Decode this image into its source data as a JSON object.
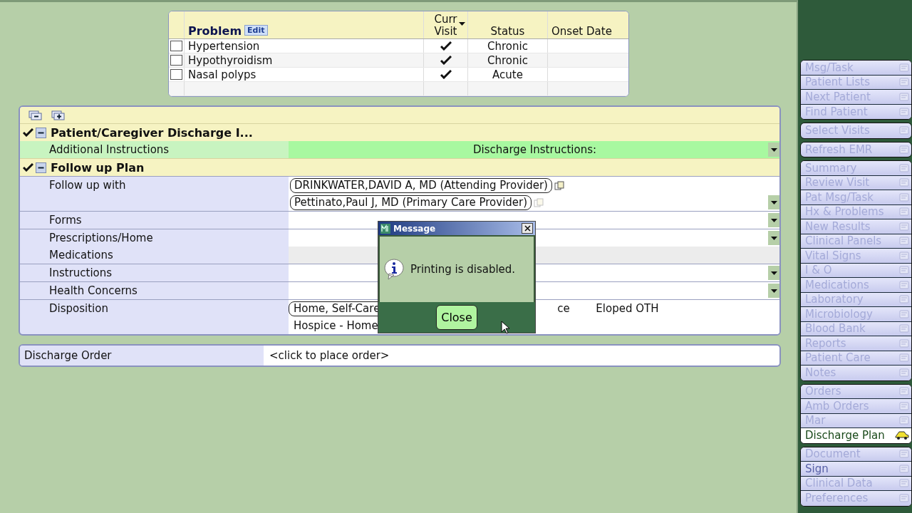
{
  "problem_list": {
    "header": {
      "problem": "Problem",
      "edit": "Edit",
      "curr_visit": "Curr Visit",
      "status": "Status",
      "onset_date": "Onset Date"
    },
    "rows": [
      {
        "checked": false,
        "problem": "Hypertension",
        "curr_visit": true,
        "status": "Chronic"
      },
      {
        "checked": false,
        "problem": "Hypothyroidism",
        "curr_visit": true,
        "status": "Chronic"
      },
      {
        "checked": false,
        "problem": "Nasal polyps",
        "curr_visit": true,
        "status": "Acute"
      }
    ]
  },
  "form": {
    "sections": [
      {
        "title": "Patient/Caregiver Discharge I...",
        "complete": true,
        "expanded": true,
        "rows": [
          {
            "kind": "banner",
            "labels": [
              "Additional Instructions"
            ],
            "value": "Discharge Instructions:",
            "dropdown": true
          }
        ]
      },
      {
        "title": "Follow up Plan",
        "complete": true,
        "expanded": true,
        "rows": [
          {
            "kind": "chips",
            "labels": [
              "Follow up with"
            ],
            "chips": [
              "DRINKWATER,DAVID A, MD (Attending Provider)",
              "Pettinato,Paul J, MD (Primary Care Provider)"
            ],
            "dropdown": true
          },
          {
            "kind": "select",
            "labels": [
              "Forms"
            ],
            "dropdown": true
          },
          {
            "kind": "select",
            "labels": [
              "Prescriptions/Home",
              "Medications"
            ],
            "dropdown": true
          },
          {
            "kind": "select",
            "labels": [
              "Instructions"
            ],
            "dropdown": true
          },
          {
            "kind": "select",
            "labels": [
              "Health Concerns"
            ],
            "dropdown": true
          },
          {
            "kind": "options",
            "labels": [
              "Disposition"
            ],
            "option_lines": [
              [
                {
                  "text": "Home, Self-Care",
                  "selected": true
                },
                {
                  "text": "ce",
                  "selected": false
                },
                {
                  "text": "Eloped OTH",
                  "selected": false
                }
              ],
              [
                {
                  "text": "Hospice - Home",
                  "selected": false
                }
              ]
            ]
          }
        ]
      }
    ]
  },
  "order": {
    "label": "Discharge Order",
    "value": "<click to place order>"
  },
  "dialog": {
    "title": "Message",
    "message": "Printing is disabled.",
    "button": "Close"
  },
  "sidebar": {
    "groups": [
      {
        "items": [
          {
            "label": "Msg/Task",
            "selected": false,
            "disabled": true
          },
          {
            "label": "Patient Lists",
            "selected": false,
            "disabled": true
          },
          {
            "label": "Next Patient",
            "selected": false,
            "disabled": true
          },
          {
            "label": "Find Patient",
            "selected": false,
            "disabled": true
          }
        ]
      },
      {
        "items": [
          {
            "label": "Select Visits",
            "selected": false,
            "disabled": true
          }
        ]
      },
      {
        "items": [
          {
            "label": "Refresh EMR",
            "selected": false,
            "disabled": true
          }
        ]
      },
      {
        "items": [
          {
            "label": "Summary",
            "selected": false,
            "disabled": true
          },
          {
            "label": "Review Visit",
            "selected": false,
            "disabled": true
          },
          {
            "label": "Pat Msg/Task",
            "selected": false,
            "disabled": true
          },
          {
            "label": "Hx & Problems",
            "selected": false,
            "disabled": true
          },
          {
            "label": "New Results",
            "selected": false,
            "disabled": true
          },
          {
            "label": "Clinical Panels",
            "selected": false,
            "disabled": true
          },
          {
            "label": "Vital Signs",
            "selected": false,
            "disabled": true
          },
          {
            "label": "I & O",
            "selected": false,
            "disabled": true
          },
          {
            "label": "Medications",
            "selected": false,
            "disabled": true
          },
          {
            "label": "Laboratory",
            "selected": false,
            "disabled": true
          },
          {
            "label": "Microbiology",
            "selected": false,
            "disabled": true
          },
          {
            "label": "Blood Bank",
            "selected": false,
            "disabled": true
          },
          {
            "label": "Reports",
            "selected": false,
            "disabled": true
          },
          {
            "label": "Patient Care",
            "selected": false,
            "disabled": true
          },
          {
            "label": "Notes",
            "selected": false,
            "disabled": true
          }
        ]
      },
      {
        "items": [
          {
            "label": "Orders",
            "selected": false,
            "disabled": true
          },
          {
            "label": "Amb Orders",
            "selected": false,
            "disabled": true
          },
          {
            "label": "Mar",
            "selected": false,
            "disabled": true
          },
          {
            "label": "Discharge Plan",
            "selected": true,
            "disabled": false
          }
        ]
      },
      {
        "items": [
          {
            "label": "Document",
            "selected": false,
            "disabled": true
          },
          {
            "label": "Sign",
            "selected": false,
            "disabled": false
          },
          {
            "label": "Clinical Data",
            "selected": false,
            "disabled": true
          },
          {
            "label": "Preferences",
            "selected": false,
            "disabled": true
          }
        ]
      }
    ]
  }
}
